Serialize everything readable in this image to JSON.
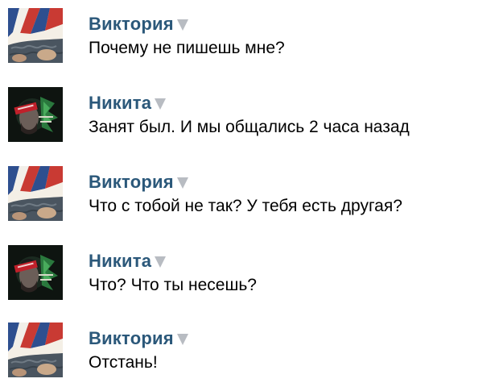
{
  "colors": {
    "name": "#2b587a",
    "text": "#000000",
    "caret": "#b8bcc2"
  },
  "messages": [
    {
      "author": "Виктория",
      "avatar": "viktoria-avatar",
      "text": "Почему не пишешь мне?"
    },
    {
      "author": "Никита",
      "avatar": "nikita-avatar",
      "text": "Занят был. И мы общались 2 часа назад"
    },
    {
      "author": "Виктория",
      "avatar": "viktoria-avatar",
      "text": "Что с тобой не так? У тебя есть другая?"
    },
    {
      "author": "Никита",
      "avatar": "nikita-avatar",
      "text": "Что? Что ты несешь?"
    },
    {
      "author": "Виктория",
      "avatar": "viktoria-avatar",
      "text": "Отстань!"
    }
  ]
}
